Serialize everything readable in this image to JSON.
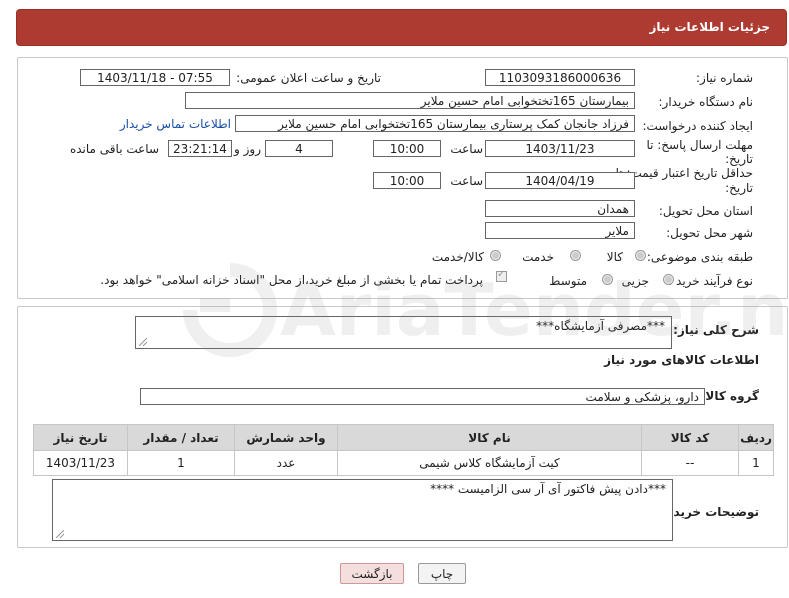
{
  "header": {
    "title": "جزئیات اطلاعات نیاز"
  },
  "form": {
    "need_number_label": "شماره نیاز:",
    "need_number": "1103093186000636",
    "announce_label": "تاریخ و ساعت اعلان عمومی:",
    "announce_value": "1403/11/18 - 07:55",
    "buyer_org_label": "نام دستگاه خریدار:",
    "buyer_org": "بیمارستان 165تختخوابی امام حسین ملایر",
    "creator_label": "ایجاد کننده درخواست:",
    "creator": "فرزاد جانجان کمک پرستاری بیمارستان 165تختخوابی امام حسین ملایر",
    "contact_link": "اطلاعات تماس خریدار",
    "deadline_label_1": "مهلت ارسال پاسخ: تا",
    "deadline_label_2": "تاریخ:",
    "deadline_date": "1403/11/23",
    "time_label": "ساعت",
    "deadline_time": "10:00",
    "days_value": "4",
    "days_label": "روز و",
    "remaining_value": "23:21:14",
    "remaining_label": "ساعت باقی مانده",
    "validity_label_1": "حداقل تاریخ اعتبار قیمت: تا",
    "validity_label_2": "تاریخ:",
    "validity_date": "1404/04/19",
    "validity_time": "10:00",
    "province_label": "استان محل تحویل:",
    "province": "همدان",
    "city_label": "شهر محل تحویل:",
    "city": "ملایر",
    "category_label": "طبقه بندی موضوعی:",
    "category_options": [
      "کالا",
      "خدمت",
      "کالا/خدمت"
    ],
    "process_label": "نوع فرآیند خرید :",
    "process_options": [
      "جزیی",
      "متوسط"
    ],
    "payment_note": "پرداخت تمام یا بخشی از مبلغ خرید،از محل \"اسناد خزانه اسلامی\" خواهد بود."
  },
  "details": {
    "description_label": "شرح کلی نیاز:",
    "description": "***مصرفی آزمایشگاه***",
    "goods_info_title": "اطلاعات کالاهای مورد نیاز",
    "goods_group_label": "گروه کالا:",
    "goods_group": "دارو، پزشکی و سلامت",
    "table": {
      "headers": [
        "ردیف",
        "کد کالا",
        "نام کالا",
        "واحد شمارش",
        "تعداد / مقدار",
        "تاریخ نیاز"
      ],
      "rows": [
        [
          "1",
          "--",
          "کیت آزمایشگاه کلاس شیمی",
          "عدد",
          "1",
          "1403/11/23"
        ]
      ]
    },
    "buyer_notes_label": "توضیحات خریدار:",
    "buyer_notes": "***دادن پیش فاکتور آی آر سی الزامیست ****"
  },
  "buttons": {
    "print": "چاپ",
    "back": "بازگشت"
  },
  "watermark_text": "AriaTender.neT"
}
